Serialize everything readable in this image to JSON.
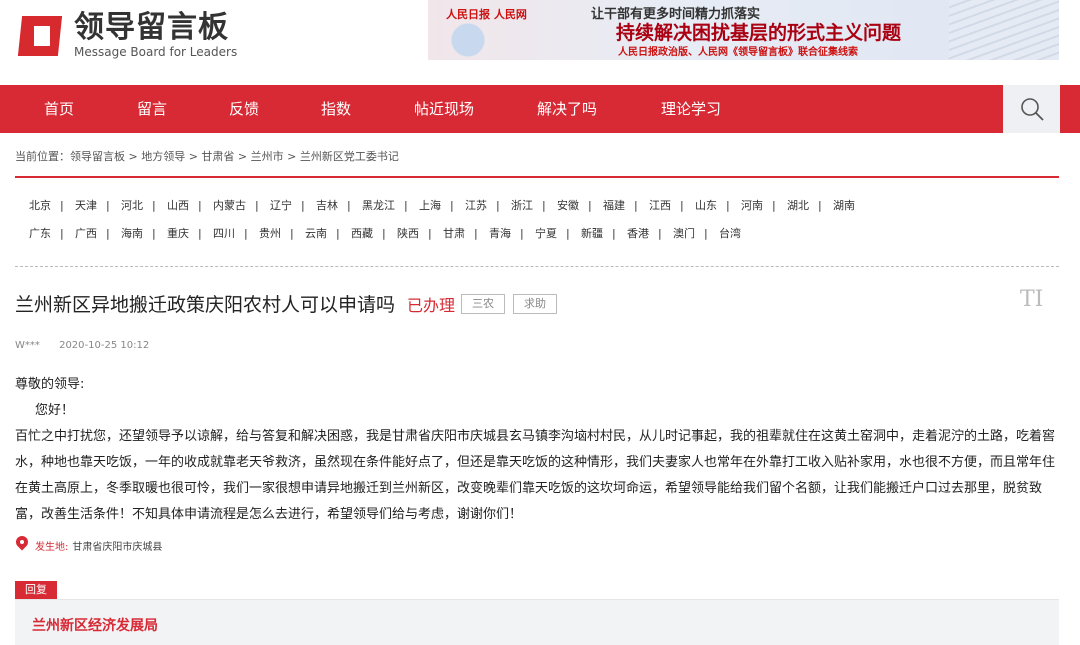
{
  "header": {
    "logo_cn": "领导留言板",
    "logo_en": "Message Board for Leaders",
    "banner": {
      "logos": "人民日报 人民网",
      "small": "让干部有更多时间精力抓落实",
      "big": "持续解决困扰基层的形式主义问题",
      "sub": "人民日报政治版、人民网《领导留言板》联合征集线索"
    }
  },
  "nav": {
    "items": [
      "首页",
      "留言",
      "反馈",
      "指数",
      "帖近现场",
      "解决了吗",
      "理论学习"
    ]
  },
  "breadcrumb": "当前位置：领导留言板 > 地方领导 > 甘肃省 > 兰州市 > 兰州新区党工委书记",
  "provinces": {
    "row1": [
      "北京",
      "天津",
      "河北",
      "山西",
      "内蒙古",
      "辽宁",
      "吉林",
      "黑龙江",
      "上海",
      "江苏",
      "浙江",
      "安徽",
      "福建",
      "江西",
      "山东",
      "河南",
      "湖北",
      "湖南"
    ],
    "row2": [
      "广东",
      "广西",
      "海南",
      "重庆",
      "四川",
      "贵州",
      "云南",
      "西藏",
      "陕西",
      "甘肃",
      "青海",
      "宁夏",
      "新疆",
      "香港",
      "澳门",
      "台湾"
    ]
  },
  "post": {
    "title": "兰州新区异地搬迁政策庆阳农村人可以申请吗",
    "status": "已办理",
    "tags": [
      "三农",
      "求助"
    ],
    "font_icon": "TI",
    "author": "W***",
    "time": "2020-10-25 10:12",
    "greeting": "尊敬的领导:",
    "hello": "您好！",
    "body": "百忙之中打扰您，还望领导予以谅解，给与答复和解决困惑，我是甘肃省庆阳市庆城县玄马镇李沟垴村村民，从儿时记事起，我的祖辈就住在这黄土窑洞中，走着泥泞的土路，吃着窖水，种地也靠天吃饭，一年的收成就靠老天爷救济，虽然现在条件能好点了，但还是靠天吃饭的这种情形，我们夫妻家人也常年在外靠打工收入贴补家用，水也很不方便，而且常年住在黄土高原上，冬季取暖也很可怜，我们一家很想申请异地搬迁到兰州新区，改变晚辈们靠天吃饭的这坎坷命运，希望领导能给我们留个名额，让我们能搬迁户口过去那里，脱贫致富，改善生活条件！不知具体申请流程是怎么去进行，希望领导们给与考虑，谢谢你们！",
    "place_label": "发生地:",
    "place": "甘肃省庆阳市庆城县"
  },
  "reply": {
    "tag": "回复",
    "org": "兰州新区经济发展局"
  },
  "colors": {
    "accent": "#d72a35"
  }
}
